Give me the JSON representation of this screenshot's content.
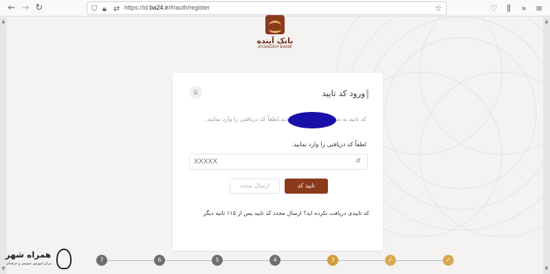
{
  "browser": {
    "url_prefix": "https://id.",
    "url_domain": "ba24.ir",
    "url_path": "/#/auth/register"
  },
  "logo": {
    "fa": "بانک آینده",
    "en": "AYANDEH BANK"
  },
  "card": {
    "title": "ورود کد تایید",
    "description": "کد تایید به شماره تلفن                ارسال گردید.لطفاً کد دریافتی را وارد نمایید.",
    "field_label": "لطفاً کد دریافتی را وارد نمایید.",
    "code_placeholder": "XXXXX",
    "confirm_label": "تایید کد",
    "resend_label": "ارسال مجدد",
    "note": "کد تاییدی دریافت نکرده اید؟ ارسال مجدد کد تایید پس از ۱۱۵ ثانیه دیگر"
  },
  "steps": [
    {
      "label": "7",
      "state": "todo"
    },
    {
      "label": "6",
      "state": "todo"
    },
    {
      "label": "5",
      "state": "todo"
    },
    {
      "label": "4",
      "state": "todo"
    },
    {
      "label": "3",
      "state": "current"
    },
    {
      "label": "✓",
      "state": "done"
    },
    {
      "label": "✓",
      "state": "done"
    }
  ],
  "watermark": {
    "title": "همراه شهر",
    "sub": "مرکز آموزش عمومی و حرفه‌ای"
  },
  "colors": {
    "brand": "#8b3a1c",
    "step_done": "#d9a94e",
    "step_todo": "#6f6f6f"
  }
}
